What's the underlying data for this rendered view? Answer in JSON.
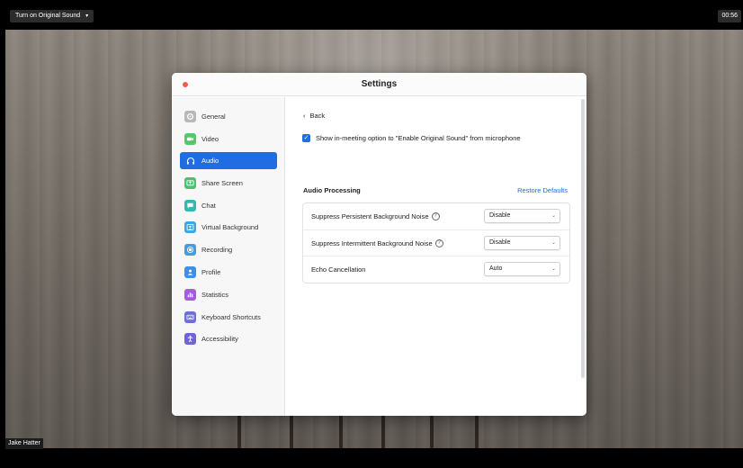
{
  "meeting": {
    "original_sound_button": "Turn on Original Sound",
    "timer": "00:56",
    "participant_name": "Jake Hatter"
  },
  "settings_window": {
    "title": "Settings",
    "sidebar": {
      "items": [
        {
          "label": "General",
          "icon": "gear-icon",
          "color": "#b8b8b8",
          "active": false
        },
        {
          "label": "Video",
          "icon": "video-camera-icon",
          "color": "#58c46b",
          "active": false
        },
        {
          "label": "Audio",
          "icon": "headphones-icon",
          "color": "#1f6de0",
          "active": true
        },
        {
          "label": "Share Screen",
          "icon": "share-screen-icon",
          "color": "#4cc072",
          "active": false
        },
        {
          "label": "Chat",
          "icon": "chat-bubble-icon",
          "color": "#33b8b0",
          "active": false
        },
        {
          "label": "Virtual Background",
          "icon": "person-portrait-icon",
          "color": "#3fa6e0",
          "active": false
        },
        {
          "label": "Recording",
          "icon": "record-icon",
          "color": "#3f9ee8",
          "active": false
        },
        {
          "label": "Profile",
          "icon": "profile-icon",
          "color": "#3f8fe8",
          "active": false
        },
        {
          "label": "Statistics",
          "icon": "bar-chart-icon",
          "color": "#a45fd8",
          "active": false
        },
        {
          "label": "Keyboard Shortcuts",
          "icon": "keyboard-icon",
          "color": "#6d6fd8",
          "active": false
        },
        {
          "label": "Accessibility",
          "icon": "accessibility-icon",
          "color": "#6f63d6",
          "active": false
        }
      ]
    },
    "content": {
      "back_label": "Back",
      "original_sound_option": {
        "label": "Show in-meeting option to \"Enable Original Sound\" from microphone",
        "checked": true
      },
      "audio_processing": {
        "title": "Audio Processing",
        "restore_defaults": "Restore Defaults",
        "rows": [
          {
            "label": "Suppress Persistent Background Noise",
            "help": true,
            "value": "Disable"
          },
          {
            "label": "Suppress Intermittent Background Noise",
            "help": true,
            "value": "Disable"
          },
          {
            "label": "Echo Cancellation",
            "help": false,
            "value": "Auto"
          }
        ]
      }
    }
  },
  "colors": {
    "accent": "#1f6de0",
    "close_button": "#ee5d52"
  }
}
